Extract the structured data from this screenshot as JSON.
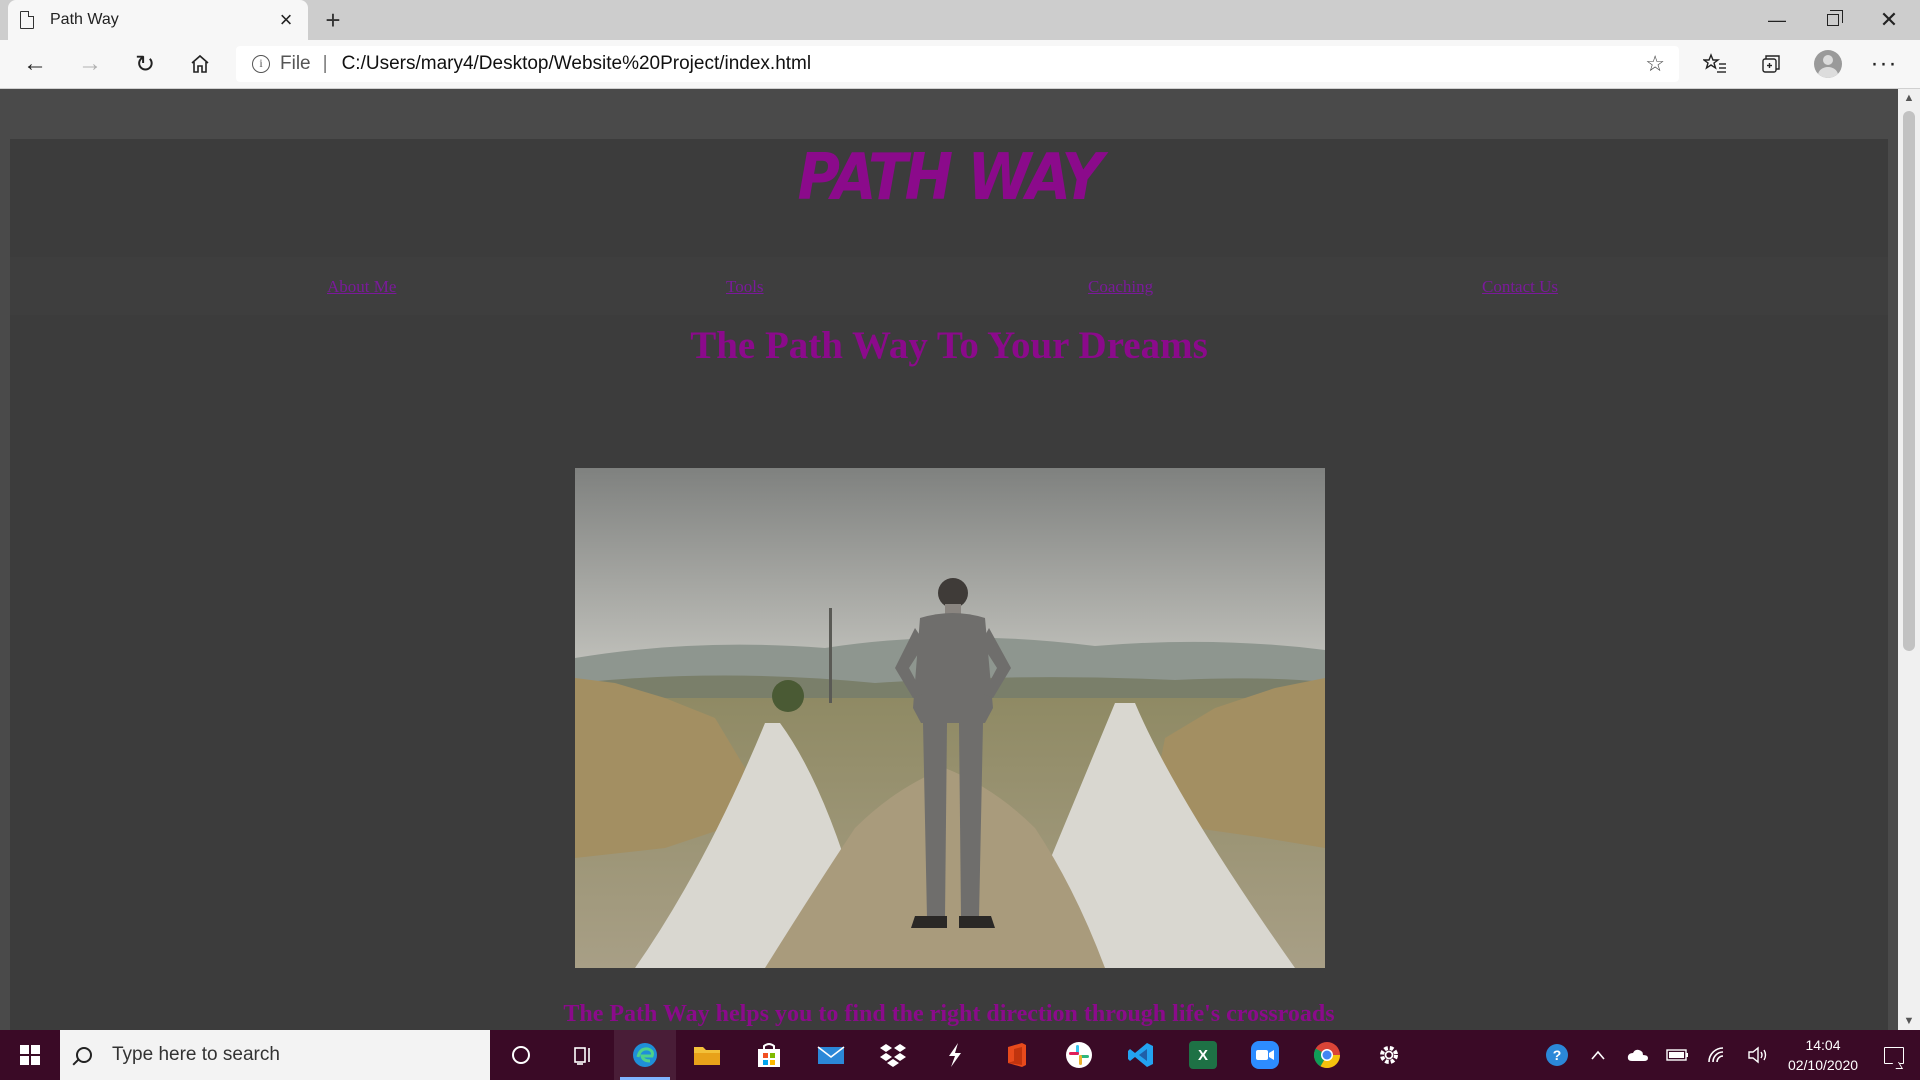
{
  "browser": {
    "tab_title": "Path Way",
    "address": {
      "scheme": "File",
      "url": "C:/Users/mary4/Desktop/Website%20Project/index.html"
    }
  },
  "site": {
    "logo": "PATH WAY",
    "nav": [
      "About Me",
      "Tools",
      "Coaching",
      "Contact Us"
    ],
    "headline": "The Path Way To Your Dreams",
    "hero_image": "man-at-crossroads-photo",
    "below_text": "The Path Way helps you to find the right direction through life's crossroads"
  },
  "taskbar": {
    "search_placeholder": "Type here to search",
    "time": "14:04",
    "date": "02/10/2020"
  },
  "colors": {
    "brand_purple": "#8b0a8b",
    "page_bg": "#3c3c3c",
    "taskbar_bg": "#3a0a26"
  }
}
